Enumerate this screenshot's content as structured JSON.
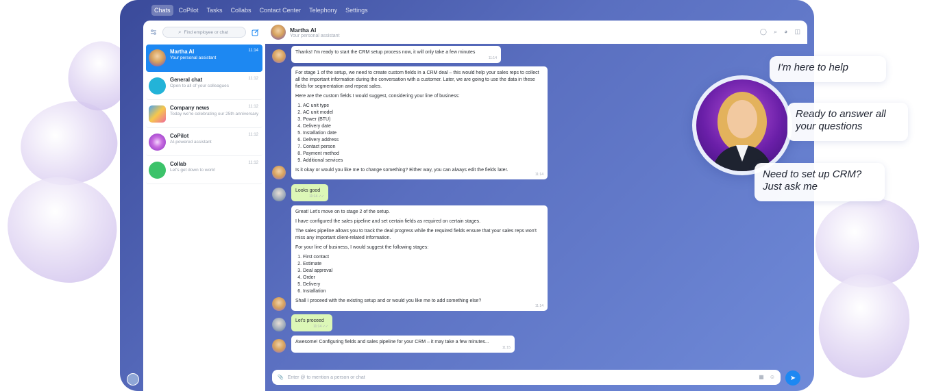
{
  "nav": {
    "tabs": [
      "Chats",
      "CoPilot",
      "Tasks",
      "Collabs",
      "Contact Center",
      "Telephony",
      "Settings"
    ],
    "active_tab": "Chats"
  },
  "sidebar": {
    "search_placeholder": "Find employee or chat",
    "items": [
      {
        "name": "Martha AI",
        "sub": "Your personal assistant",
        "time": "11:14",
        "active": true
      },
      {
        "name": "General chat",
        "sub": "Open to all of your colleagues",
        "time": "11:12"
      },
      {
        "name": "Company news",
        "sub": "Today we're celebrating our 25th anniversary",
        "time": "11:12"
      },
      {
        "name": "CoPilot",
        "sub": "AI-powered assistant",
        "time": "11:12"
      },
      {
        "name": "Collab",
        "sub": "Let's get down to work!",
        "time": "11:12"
      }
    ]
  },
  "conversation": {
    "name": "Martha AI",
    "subtitle": "Your personal assistant",
    "messages": {
      "m1": {
        "text": "Thanks! I'm ready to start the CRM setup process now, it will only take a few minutes",
        "time": "11:14"
      },
      "m2": {
        "p1": "For stage 1 of the setup, we need to create custom fields in a CRM deal – this would help your sales reps to collect all the important information during the conversation with a customer. Later, we are going to use the data in these fields for segmentation and repeat sales.",
        "p2": "Here are the custom fields I would suggest, considering your line of business:",
        "list": [
          "AC unit type",
          "AC unit model",
          "Power (BTU)",
          "Delivery date",
          "Installation date",
          "Delivery address",
          "Contact person",
          "Payment method",
          "Additional services"
        ],
        "p3": "Is it okay or would you like me to change something? Either way, you can always edit the fields later.",
        "time": "11:14"
      },
      "m3": {
        "text": "Looks good",
        "time": "11:14 ✓✓"
      },
      "m4": {
        "p1": "Great! Let's move on to stage 2 of the setup.",
        "p2": "I have configured the sales pipeline and set certain fields as required on certain stages.",
        "p3": "The sales pipeline allows you to track the deal progress while the required fields ensure that your sales reps won't miss any important client-related information.",
        "p4": "For your line of business, I would suggest the following stages:",
        "list": [
          "First contact",
          "Estimate",
          "Deal approval",
          "Order",
          "Delivery",
          "Installation"
        ],
        "p5": "Shall I proceed with the existing setup and or would you like me to add something else?",
        "time": "11:14"
      },
      "m5": {
        "text": "Let's proceed",
        "time": "11:14 ✓✓"
      },
      "m6": {
        "text": "Awesome! Configuring fields and sales pipeline for your CRM – it may take a few minutes...",
        "time": "11:15"
      }
    }
  },
  "composer": {
    "placeholder": "Enter @ to mention a person or chat"
  },
  "callouts": {
    "c1": "I'm here to help",
    "c2": "Ready to answer all your questions",
    "c3": "Need to set up CRM? Just ask me"
  },
  "colors": {
    "accent": "#1d88f2",
    "user_bubble": "#dcf7b7",
    "app_bg": "#5a6fc0"
  },
  "icons": [
    "filter-icon",
    "search-icon",
    "compose-icon",
    "user-icon",
    "magnifier-icon",
    "globe-icon",
    "panel-icon",
    "attach-icon",
    "grid-icon",
    "emoji-icon",
    "send-icon"
  ]
}
